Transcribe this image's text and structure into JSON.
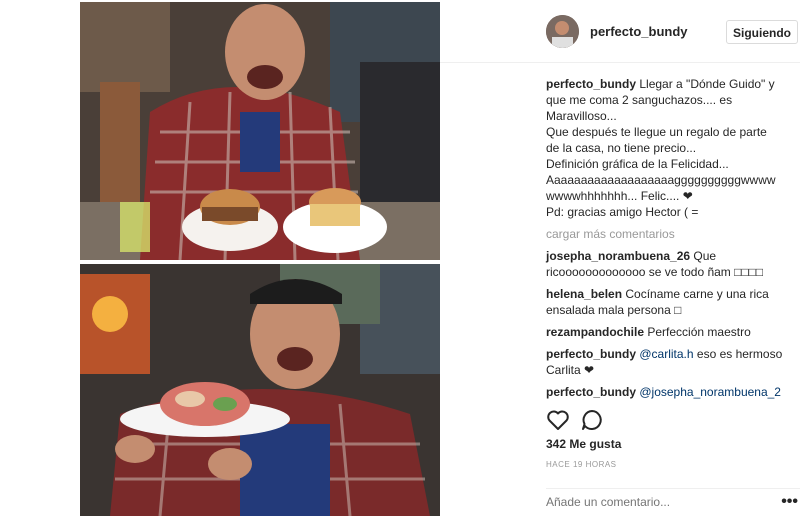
{
  "post": {
    "owner": "perfecto_bundy",
    "follow_label": "Siguiendo",
    "caption_lines": [
      "Llegar a \"Dónde Guido\" y",
      "que me coma 2 sanguchazos.... es",
      "Maravilloso...",
      "Que después te llegue un regalo de parte",
      "de la casa, no tiene precio...",
      "Definición gráfica de la Felicidad...",
      "Aaaaaaaaaaaaaaaaaaaggggggggggwwww",
      "wwwwhhhhhhh... Felic.... ❤",
      "Pd: gracias amigo Hector ( ="
    ],
    "load_more": "cargar más comentarios",
    "comments": [
      {
        "user": "josepha_norambuena_26",
        "lines": [
          "Que",
          "ricooooooooooooo se ve todo ñam □□□□"
        ]
      },
      {
        "user": "helena_belen",
        "lines": [
          "Cocíname carne y una rica",
          "ensalada mala persona □"
        ]
      },
      {
        "user": "rezampandochile",
        "lines": [
          "Perfección maestro"
        ]
      },
      {
        "user": "perfecto_bundy",
        "mention": "@carlita.h",
        "lines": [
          " eso es hermoso",
          "Carlita ❤"
        ]
      },
      {
        "user": "perfecto_bundy",
        "mention": "@josepha_norambuena_2",
        "lines": [
          ""
        ]
      }
    ],
    "likes": "342 Me gusta",
    "time": "HACE 19 HORAS",
    "add_comment_placeholder": "Añade un comentario...",
    "more": "•••",
    "icons": {
      "like": "heart-outline-icon",
      "comment": "speech-bubble-icon",
      "more": "ellipsis-icon"
    }
  }
}
